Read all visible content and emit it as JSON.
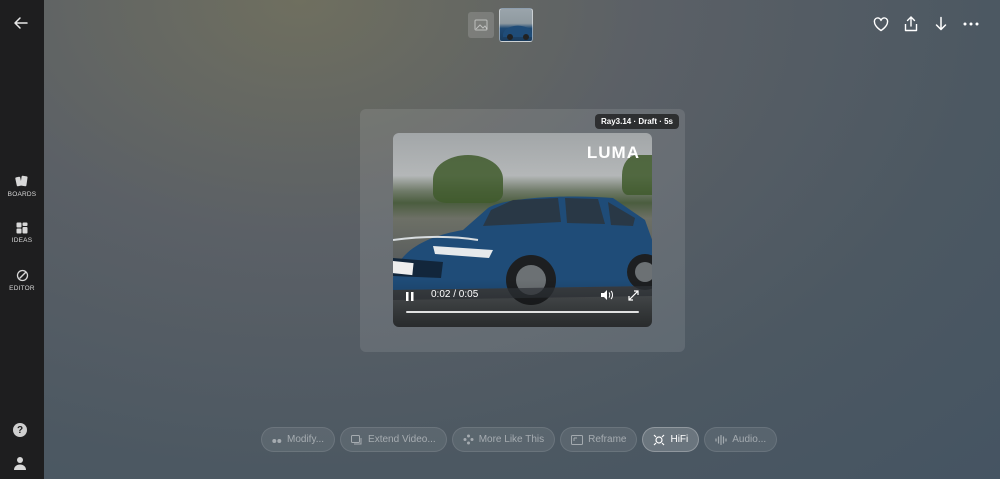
{
  "sidebar": {
    "back_icon": "arrow-left-icon",
    "items": [
      {
        "label": "BOARDS",
        "icon": "boards-icon"
      },
      {
        "label": "IDEAS",
        "icon": "ideas-icon"
      },
      {
        "label": "EDITOR",
        "icon": "editor-icon"
      }
    ],
    "help_label": "?",
    "user_icon": "user-icon"
  },
  "top_actions": [
    "heart-icon",
    "share-icon",
    "download-icon",
    "more-icon"
  ],
  "card": {
    "meta": "Ray3.14 · Draft · 5s",
    "watermark": "LUMA",
    "time": "0:02 / 0:05",
    "progress": 1.0
  },
  "actions": [
    {
      "label": "Modify...",
      "icon": "quote-icon",
      "active": false
    },
    {
      "label": "Extend Video...",
      "icon": "extend-icon",
      "active": false
    },
    {
      "label": "More Like This",
      "icon": "sparkle-icon",
      "active": false
    },
    {
      "label": "Reframe",
      "icon": "reframe-icon",
      "active": false
    },
    {
      "label": "HiFi",
      "icon": "hifi-icon",
      "active": true
    },
    {
      "label": "Audio...",
      "icon": "audio-icon",
      "active": false
    }
  ],
  "colors": {
    "sidebar_bg": "#1e1e1f",
    "car_blue": "#1f4c78"
  }
}
